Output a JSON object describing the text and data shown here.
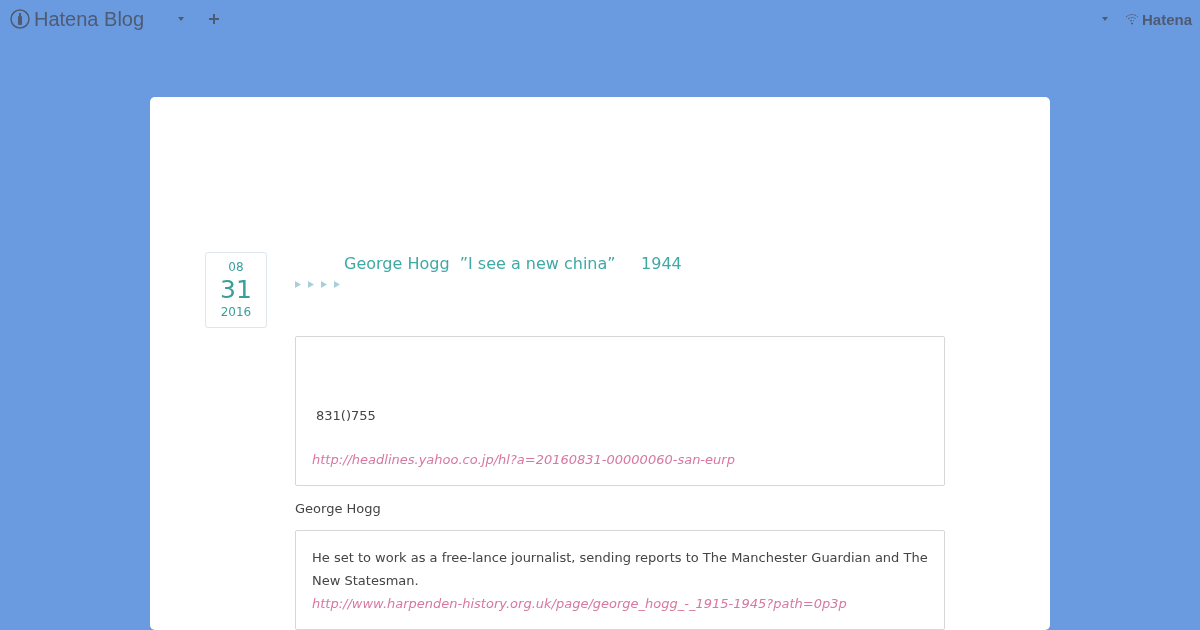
{
  "header": {
    "logo": "Hatena Blog",
    "brand": "Hatena"
  },
  "entry": {
    "date": {
      "month": "08",
      "day": "31",
      "year": "2016"
    },
    "title": "George Hogg  ”I see a new china”     1944",
    "tags": [
      {
        "kind": "marker"
      },
      {
        "kind": "marker"
      },
      {
        "kind": "marker"
      },
      {
        "kind": "marker"
      }
    ],
    "quotes": [
      {
        "text": "831()755",
        "link": "http://headlines.yahoo.co.jp/hl?a=20160831-00000060-san-eurp"
      }
    ],
    "paragraph": "George Hogg",
    "quotes2": [
      {
        "text": "He set to work as a free-lance journalist, sending reports to The Manchester Guardian and The New Statesman.",
        "link": "http://www.harpenden-history.org.uk/page/george_hogg_-_1915-1945?path=0p3p"
      }
    ]
  }
}
